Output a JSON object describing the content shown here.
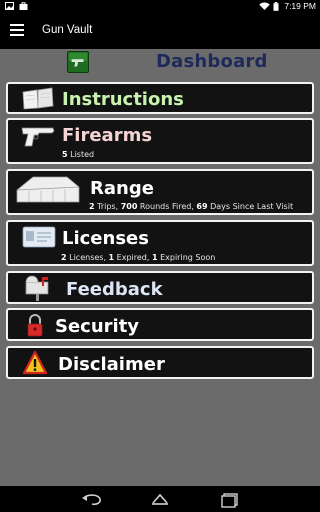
{
  "status_bar": {
    "time": "7:19 PM",
    "icons": [
      "gallery-notification-icon",
      "bag-notification-icon",
      "wifi-icon",
      "battery-icon"
    ]
  },
  "action_bar": {
    "title": "Gun Vault",
    "menu_icon": "hamburger-menu-icon"
  },
  "dashboard": {
    "title": "Dashboard",
    "icon": "green-pistol-icon"
  },
  "menu": [
    {
      "key": "instructions",
      "title": "Instructions",
      "title_color": "#c9f2b0",
      "icon": "book-icon"
    },
    {
      "key": "firearms",
      "title": "Firearms",
      "title_color": "#f6d4d4",
      "icon": "pistol-icon",
      "subtitle": {
        "n1": "5",
        "t1": " Listed"
      }
    },
    {
      "key": "range",
      "title": "Range",
      "title_color": "#ffffff",
      "icon": "range-building-icon",
      "subtitle": {
        "n1": "2",
        "t1": " Trips, ",
        "n2": "700",
        "t2": " Rounds Fired, ",
        "n3": "69",
        "t3": " Days Since Last Visit"
      }
    },
    {
      "key": "licenses",
      "title": "Licenses",
      "title_color": "#ffffff",
      "icon": "license-card-icon",
      "subtitle": {
        "n1": "2",
        "t1": " Licenses, ",
        "n2": "1",
        "t2": " Expired, ",
        "n3": "1",
        "t3": " Expiring Soon"
      }
    },
    {
      "key": "feedback",
      "title": "Feedback",
      "title_color": "#dde6f7",
      "icon": "mailbox-icon"
    },
    {
      "key": "security",
      "title": "Security",
      "title_color": "#ffffff",
      "icon": "padlock-icon"
    },
    {
      "key": "disclaimer",
      "title": "Disclaimer",
      "title_color": "#ffffff",
      "icon": "warning-icon"
    }
  ],
  "nav_bar": {
    "back": "back-icon",
    "home": "home-icon",
    "recents": "recents-icon"
  }
}
